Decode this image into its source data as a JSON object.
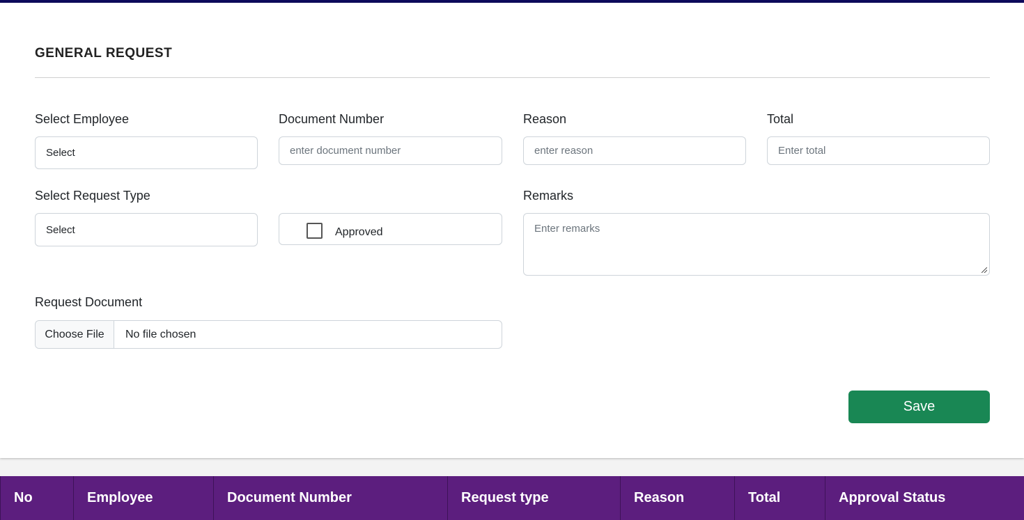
{
  "page": {
    "title": "GENERAL REQUEST"
  },
  "form": {
    "employee": {
      "label": "Select Employee",
      "value": "Select"
    },
    "document_number": {
      "label": "Document Number",
      "placeholder": "enter document number"
    },
    "reason": {
      "label": "Reason",
      "placeholder": "enter reason"
    },
    "total": {
      "label": "Total",
      "placeholder": "Enter total"
    },
    "request_type": {
      "label": "Select Request Type",
      "value": "Select"
    },
    "approved": {
      "label": "Approved",
      "checked": false
    },
    "remarks": {
      "label": "Remarks",
      "placeholder": "Enter remarks"
    },
    "request_document": {
      "label": "Request Document",
      "button_label": "Choose File",
      "status": "No file chosen"
    },
    "save_label": "Save"
  },
  "table": {
    "columns": [
      "No",
      "Employee",
      "Document Number",
      "Request type",
      "Reason",
      "Total",
      "Approval Status"
    ]
  },
  "colors": {
    "accent_top": "#0d0a5c",
    "save_button": "#198754",
    "table_header": "#5c1e7e"
  }
}
